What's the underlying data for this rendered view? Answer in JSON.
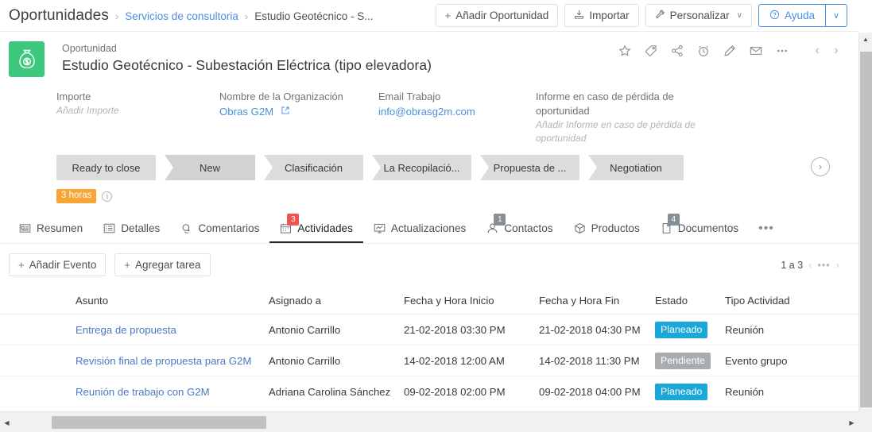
{
  "breadcrumb": {
    "root": "Oportunidades",
    "sep": "›",
    "link": "Servicios de consultoria",
    "current": "Estudio Geotécnico - S..."
  },
  "toolbar": {
    "add_label": "Añadir Oportunidad",
    "add_icon": "plus-icon",
    "import_label": "Importar",
    "import_icon": "import-icon",
    "customize_label": "Personalizar",
    "customize_icon": "wrench-icon",
    "customize_caret": "∨",
    "help_label": "Ayuda",
    "help_icon": "question-circle-icon",
    "help_caret": "∨"
  },
  "record": {
    "module": "Oportunidad",
    "title": "Estudio Geotécnico - Subestación Eléctrica (tipo elevadora)",
    "icon": "money-bag-icon",
    "icon_color": "#3ec87e",
    "actions": [
      {
        "name": "favorite-star-icon"
      },
      {
        "name": "tag-icon"
      },
      {
        "name": "share-icon"
      },
      {
        "name": "alarm-clock-icon"
      },
      {
        "name": "edit-pencil-icon"
      },
      {
        "name": "envelope-icon"
      },
      {
        "name": "more-ellipsis-icon"
      }
    ],
    "prev": "‹",
    "next": "›"
  },
  "fields": [
    {
      "label": "Importe",
      "value": "Añadir Importe",
      "type": "placeholder"
    },
    {
      "label": "Nombre de la Organización",
      "value": "Obras G2M",
      "type": "link",
      "external_icon": "external-link-icon"
    },
    {
      "label": "Email Trabajo",
      "value": "info@obrasg2m.com",
      "type": "link"
    },
    {
      "label": "Informe en caso de pérdida de oportunidad",
      "value": "Añadir Informe en caso de pérdida de oportunidad",
      "type": "placeholder"
    }
  ],
  "pipeline": {
    "stages": [
      {
        "label": "Ready to close",
        "current": false
      },
      {
        "label": "New",
        "current": true
      },
      {
        "label": "Clasificación",
        "current": false
      },
      {
        "label": "La Recopilació...",
        "current": false
      },
      {
        "label": "Propuesta de ...",
        "current": false
      },
      {
        "label": "Negotiation",
        "current": false
      }
    ],
    "next_icon": "chevron-right-circle-icon",
    "next_glyph": "›",
    "duration_badge": "3 horas",
    "duration_badge_color": "#f7a536",
    "info_icon": "info-icon",
    "info_glyph": "i",
    "marker_color": "#3b7ddd"
  },
  "tabs": [
    {
      "label": "Resumen",
      "icon": "summary-card-icon",
      "badge": null,
      "active": false
    },
    {
      "label": "Detalles",
      "icon": "list-details-icon",
      "badge": null,
      "active": false
    },
    {
      "label": "Comentarios",
      "icon": "comment-bubble-icon",
      "badge": null,
      "active": false
    },
    {
      "label": "Actividades",
      "icon": "calendar-icon",
      "badge": "3",
      "badge_color": "#ef5350",
      "active": true
    },
    {
      "label": "Actualizaciones",
      "icon": "chart-monitor-icon",
      "badge": null,
      "active": false
    },
    {
      "label": "Contactos",
      "icon": "user-icon",
      "badge": "1",
      "badge_color": "#868e96",
      "active": false
    },
    {
      "label": "Productos",
      "icon": "box-icon",
      "badge": null,
      "active": false
    },
    {
      "label": "Documentos",
      "icon": "document-icon",
      "badge": "4",
      "badge_color": "#868e96",
      "active": false
    }
  ],
  "tabs_more": "•••",
  "activities": {
    "add_event_label": "Añadir Evento",
    "add_task_label": "Agregar tarea",
    "pager": {
      "range": "1 a 3",
      "prev": "‹",
      "dots": "•••",
      "next": "›"
    },
    "columns": [
      "Asunto",
      "Asignado a",
      "Fecha y Hora Inicio",
      "Fecha y Hora Fin",
      "Estado",
      "Tipo Actividad"
    ],
    "rows": [
      {
        "asunto": "Entrega de propuesta",
        "asignado": "Antonio Carrillo",
        "inicio": "21-02-2018 03:30 PM",
        "fin": "21-02-2018 04:30 PM",
        "estado": "Planeado",
        "estado_style": "planeado",
        "tipo": "Reunión"
      },
      {
        "asunto": "Revisión final de propuesta para G2M",
        "asignado": "Antonio Carrillo",
        "inicio": "14-02-2018 12:00 AM",
        "fin": "14-02-2018 11:30 PM",
        "estado": "Pendiente",
        "estado_style": "pendiente",
        "tipo": "Evento grupo"
      },
      {
        "asunto": "Reunión de trabajo con G2M",
        "asignado": "Adriana Carolina Sánchez",
        "inicio": "09-02-2018 02:00 PM",
        "fin": "09-02-2018 04:00 PM",
        "estado": "Planeado",
        "estado_style": "planeado",
        "tipo": "Reunión"
      }
    ]
  },
  "scrollbars": {
    "v_up": "▲",
    "h_left": "◀",
    "h_right": "▶"
  }
}
